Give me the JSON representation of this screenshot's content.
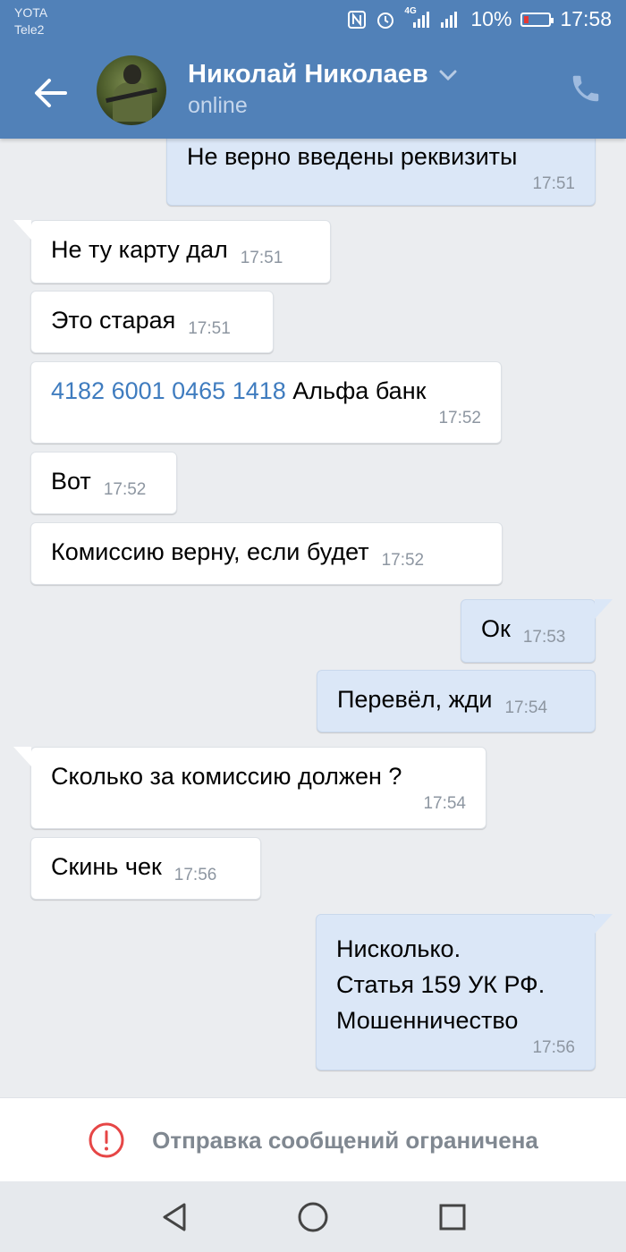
{
  "status_bar": {
    "carrier_1": "YOTA",
    "carrier_2": "Tele2",
    "signal_text": "4G",
    "battery": "10%",
    "time": "17:58"
  },
  "header": {
    "contact_name": "Николай Николаев",
    "contact_status": "online"
  },
  "messages": [
    {
      "dir": "out",
      "text": "Не верно введены реквизиты",
      "time": "17:51"
    },
    {
      "dir": "in",
      "text": "Не ту карту дал",
      "time": "17:51"
    },
    {
      "dir": "in",
      "text": "Это старая",
      "time": "17:51"
    },
    {
      "dir": "in",
      "card": "4182 6001 0465 1418",
      "text": " Альфа банк",
      "time": "17:52"
    },
    {
      "dir": "in",
      "text": "Вот",
      "time": "17:52"
    },
    {
      "dir": "in",
      "text": "Комиссию верну, если будет",
      "time": "17:52"
    },
    {
      "dir": "out",
      "text": "Ок",
      "time": "17:53"
    },
    {
      "dir": "out",
      "text": "Перевёл, жди",
      "time": "17:54"
    },
    {
      "dir": "in",
      "text": "Сколько за комиссию должен ?",
      "time": "17:54"
    },
    {
      "dir": "in",
      "text": "Скинь чек",
      "time": "17:56"
    },
    {
      "dir": "out",
      "lines": [
        "Нисколько.",
        "Статья 159 УК РФ.",
        "Мошенничество"
      ],
      "time": "17:56"
    }
  ],
  "footer": {
    "restricted_text": "Отправка сообщений ограничена"
  },
  "colors": {
    "header": "#5181b8",
    "incoming_bubble": "#ffffff",
    "outgoing_bubble": "#dbe7f7",
    "link": "#3f7cbf",
    "warning": "#e64646"
  },
  "icons": {
    "back": "arrow-left-icon",
    "call": "phone-icon",
    "warning": "exclamation-circle-icon",
    "nav_back": "triangle-back-icon",
    "nav_home": "circle-home-icon",
    "nav_recent": "square-recent-icon"
  }
}
